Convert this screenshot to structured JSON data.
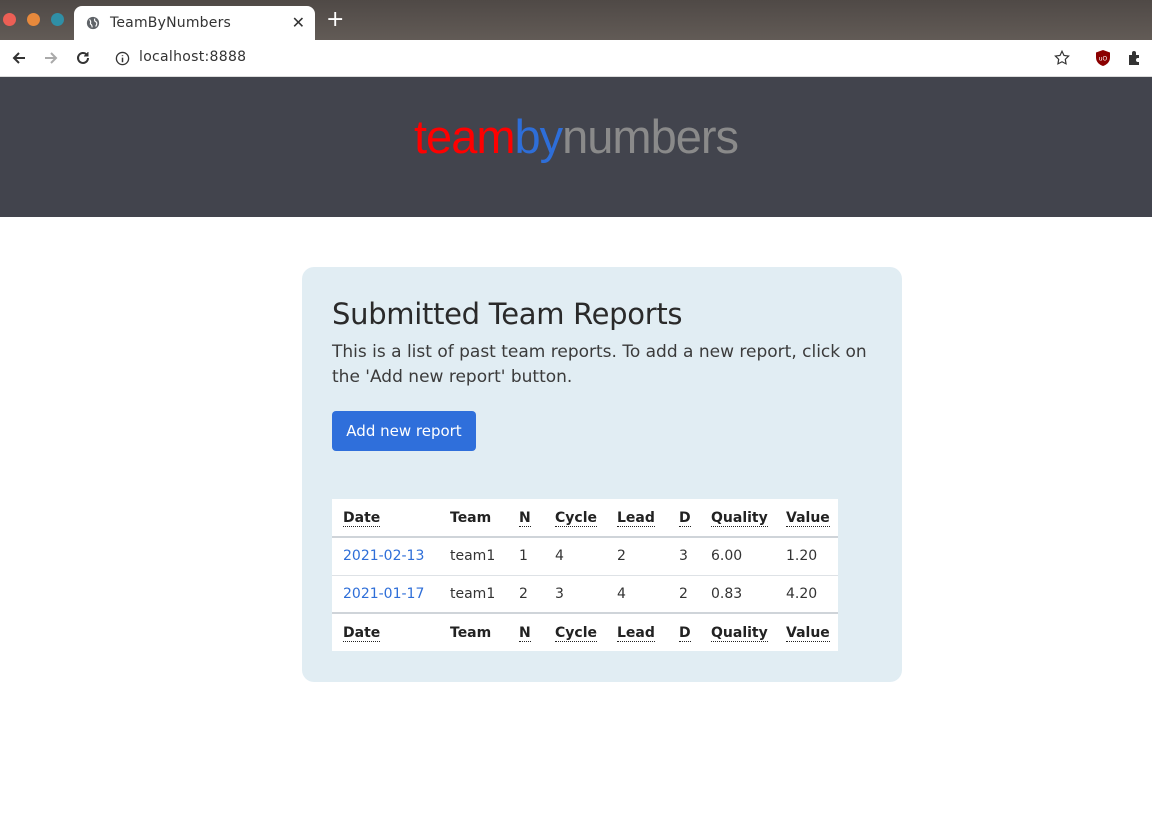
{
  "browser": {
    "tab_title": "TeamByNumbers",
    "tab_close": "✕",
    "new_tab": "+",
    "url": "localhost:8888"
  },
  "logo": {
    "part1": "team",
    "part2": "by",
    "part3": "numbers",
    "colors": {
      "part1": "#ff0000",
      "part2": "#2e6ed8",
      "part3": "#8a8a8a"
    }
  },
  "panel": {
    "title": "Submitted Team Reports",
    "description": "This is a list of past team reports. To add a new report, click on the 'Add new report' button.",
    "add_button": "Add new report"
  },
  "table": {
    "headers": [
      "Date",
      "Team",
      "N",
      "Cycle",
      "Lead",
      "D",
      "Quality",
      "Value"
    ],
    "rows": [
      [
        "2021-02-13",
        "team1",
        "1",
        "4",
        "2",
        "3",
        "6.00",
        "1.20"
      ],
      [
        "2021-01-17",
        "team1",
        "2",
        "3",
        "4",
        "2",
        "0.83",
        "4.20"
      ]
    ]
  },
  "colors": {
    "header_bg": "#42444d",
    "panel_bg": "#e1edf3",
    "accent": "#2f6fdb"
  }
}
